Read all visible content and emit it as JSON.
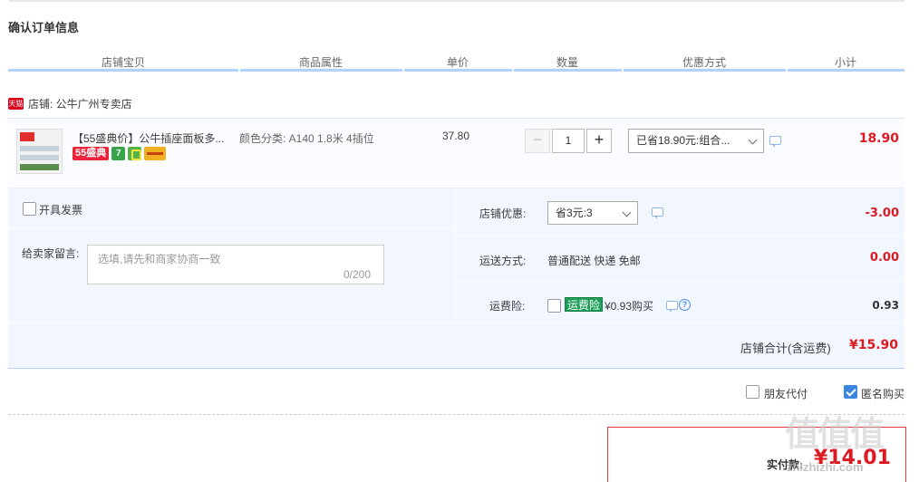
{
  "page": {
    "title": "确认订单信息"
  },
  "table_headers": [
    "店铺宝贝",
    "商品属性",
    "单价",
    "数量",
    "优惠方式",
    "小计"
  ],
  "shop": {
    "tmall_badge": "天猫",
    "label": "店铺: 公牛广州专卖店"
  },
  "item": {
    "title": "【55盛典价】公牛插座面板多...",
    "badge_55": "55盛典",
    "badge_7": "7",
    "attr": "颜色分类: A140 1.8米 4插位",
    "price": "37.80",
    "qty_minus": "−",
    "qty": "1",
    "qty_plus": "+",
    "promo_select": "已省18.90元:组合...",
    "subtotal": "18.90"
  },
  "invoice": {
    "label": "开具发票",
    "checked": false
  },
  "shop_discount": {
    "label": "店铺优惠:",
    "select": "省3元:3",
    "value": "-3.00"
  },
  "memo": {
    "label": "给卖家留言:",
    "placeholder": "选填,请先和商家协商一致",
    "count": "0/200"
  },
  "delivery": {
    "label": "运送方式:",
    "method": "普通配送 快递 免邮",
    "value": "0.00"
  },
  "insurance": {
    "label": "运费险:",
    "tag": "运费险",
    "text": "¥0.93购买",
    "help": "?",
    "value": "0.93"
  },
  "shop_total": {
    "label": "店铺合计(含运费)",
    "value": "¥15.90"
  },
  "options": {
    "friend_pay": "朋友代付",
    "anonymous": "匿名购买",
    "anonymous_checked": true
  },
  "payment": {
    "label": "实付款:",
    "amount": "¥14.01"
  },
  "watermark": {
    "main": "值值值",
    "sub": "zhizhizhi.com"
  },
  "colors": {
    "accent_red": "#dd1a21",
    "header_line": "#b2d1ff",
    "panel_bg": "#f2f7ff",
    "checkbox_blue": "#3b85e0"
  }
}
